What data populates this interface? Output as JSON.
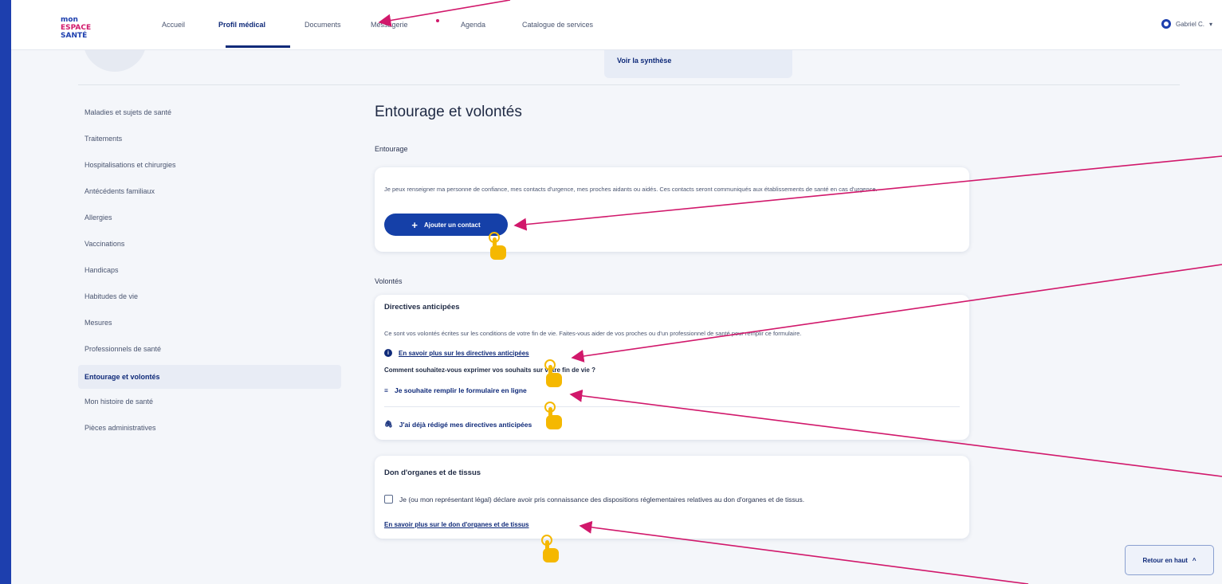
{
  "nav": {
    "logo_text": "mon ESPACE SANTÉ",
    "items": [
      {
        "label": "Accueil"
      },
      {
        "label": "Profil médical"
      },
      {
        "label": "Documents"
      },
      {
        "label": "Messagerie"
      },
      {
        "label": "Agenda"
      },
      {
        "label": "Catalogue de services"
      }
    ],
    "active_index": 1,
    "user_label": "Gabriel C."
  },
  "header": {
    "synthese_link": "Voir la synthèse"
  },
  "sidebar": {
    "items": [
      {
        "label": "Maladies et sujets de santé"
      },
      {
        "label": "Traitements"
      },
      {
        "label": "Hospitalisations et chirurgies"
      },
      {
        "label": "Antécédents familiaux"
      },
      {
        "label": "Allergies"
      },
      {
        "label": "Vaccinations"
      },
      {
        "label": "Handicaps"
      },
      {
        "label": "Habitudes de vie"
      },
      {
        "label": "Mesures"
      },
      {
        "label": "Professionnels de santé"
      },
      {
        "label": "Entourage et volontés"
      },
      {
        "label": "Mon histoire de santé"
      },
      {
        "label": "Pièces administratives"
      }
    ],
    "active_index": 10
  },
  "main": {
    "title": "Entourage et volontés",
    "entourage": {
      "section_label": "Entourage",
      "description": "Je peux renseigner ma personne de confiance, mes contacts d'urgence, mes proches aidants ou aidés. Ces contacts seront communiqués aux établissements de santé en cas d'urgence.",
      "add_button": "Ajouter un contact"
    },
    "volontes": {
      "section_label": "Volontés",
      "directives": {
        "title": "Directives anticipées",
        "description": "Ce sont vos volontés écrites sur les conditions de votre fin de vie. Faites-vous aider de vos proches ou d'un professionnel de santé pour remplir ce formulaire.",
        "info_link": "En savoir plus sur les directives anticipées",
        "question": "Comment souhaitez-vous exprimer vos souhaits sur votre fin de vie ?",
        "option_online": "Je souhaite remplir le formulaire en ligne",
        "option_upload": "J'ai déjà rédigé mes directives anticipées"
      },
      "don": {
        "title": "Don d'organes et de tissus",
        "checkbox_label": "Je (ou mon représentant légal) déclare avoir pris connaissance des dispositions réglementaires relatives au don d'organes et de tissus.",
        "info_link": "En savoir plus sur le don d'organes et de tissus"
      }
    }
  },
  "back_to_top": "Retour en haut",
  "colors": {
    "brand_blue": "#1540a8",
    "nav_active": "#0f2a79",
    "annotation_arrow": "#d1186b",
    "pointer_hand": "#f5b800"
  }
}
